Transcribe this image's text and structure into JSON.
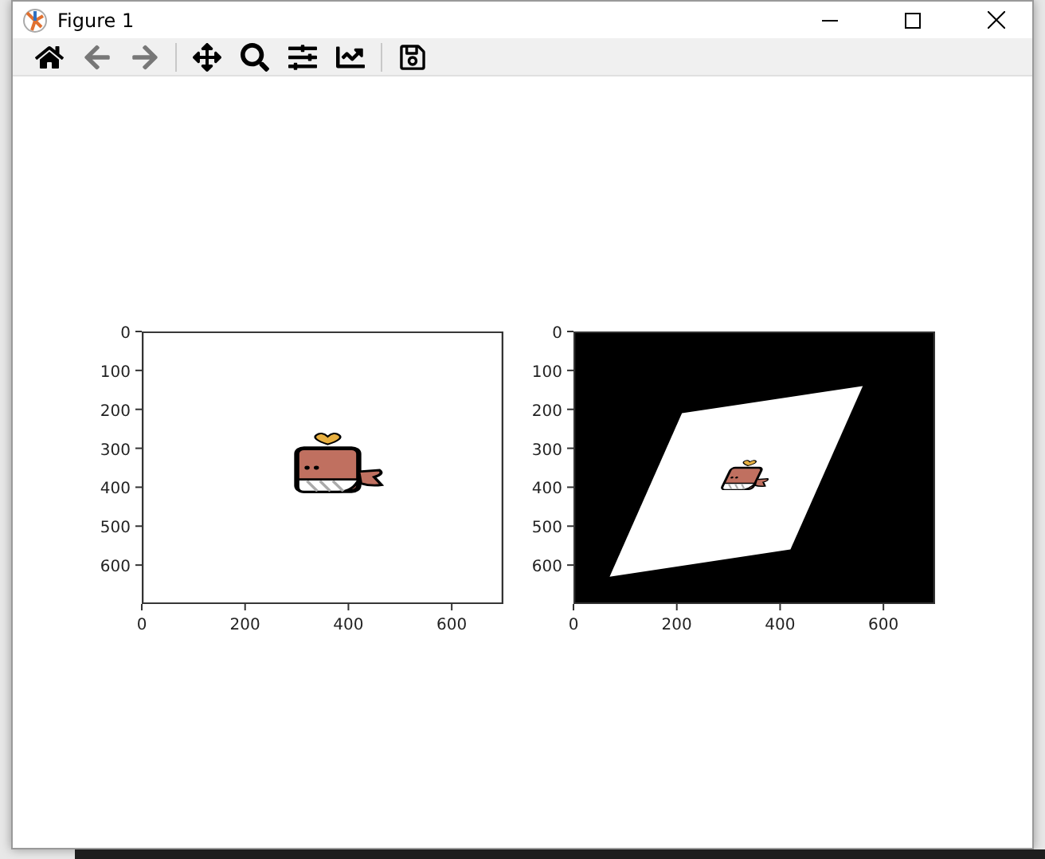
{
  "window": {
    "title": "Figure 1"
  },
  "toolbar": [
    {
      "kind": "home"
    },
    {
      "kind": "back"
    },
    {
      "kind": "forward"
    },
    {
      "kind": "separator"
    },
    {
      "kind": "pan"
    },
    {
      "kind": "zoom"
    },
    {
      "kind": "configure"
    },
    {
      "kind": "edit"
    },
    {
      "kind": "separator"
    },
    {
      "kind": "save"
    }
  ],
  "figure": {
    "subplots": [
      {
        "kind": "original",
        "xticks": [
          "0",
          "200",
          "400",
          "600"
        ],
        "yticks": [
          "0",
          "100",
          "200",
          "300",
          "400",
          "500",
          "600"
        ]
      },
      {
        "kind": "warped",
        "xticks": [
          "0",
          "200",
          "400",
          "600"
        ],
        "yticks": [
          "0",
          "100",
          "200",
          "300",
          "400",
          "500",
          "600"
        ]
      }
    ]
  }
}
